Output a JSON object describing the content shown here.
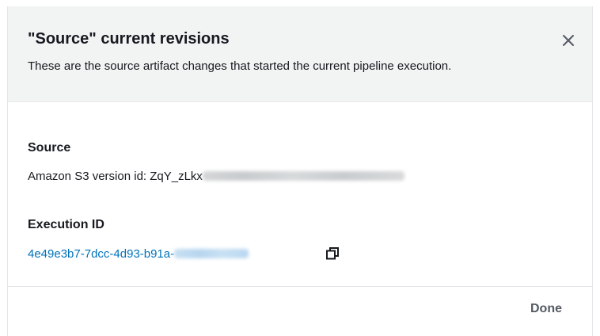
{
  "modal": {
    "title": "\"Source\" current revisions",
    "subtitle": "These are the source artifact changes that started the current pipeline execution.",
    "close_icon": "close-icon"
  },
  "source": {
    "label": "Source",
    "value_prefix": "Amazon S3 version id: ZqY_zLkx",
    "value_redacted": true
  },
  "execution": {
    "label": "Execution ID",
    "id_prefix": "4e49e3b7-7dcc-4d93-b91a-",
    "id_redacted": true,
    "copy_icon": "copy-icon"
  },
  "footer": {
    "done_label": "Done"
  },
  "colors": {
    "header_bg": "#f2f3f3",
    "link": "#0073bb",
    "text": "#16191f",
    "secondary_text": "#545b64"
  }
}
